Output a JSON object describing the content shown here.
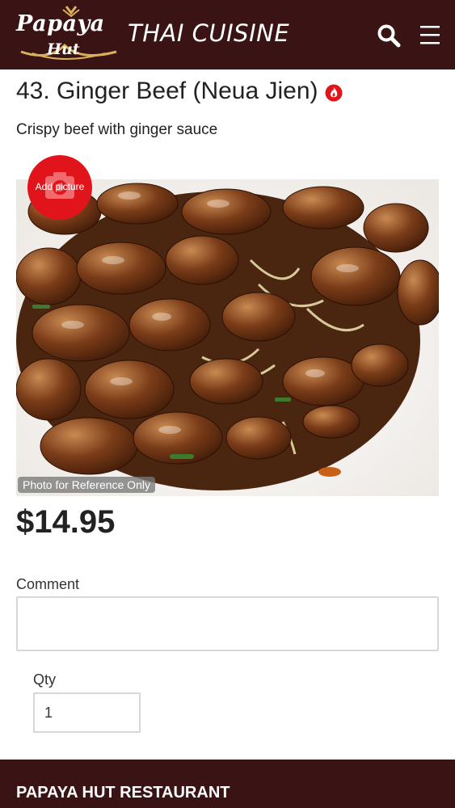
{
  "header": {
    "logo_title": "Papaya",
    "logo_sub": "Hut",
    "title": "THAI CUISINE",
    "search_icon": "search-icon",
    "menu_icon": "hamburger-menu-icon"
  },
  "dish": {
    "title": "43. Ginger Beef (Neua Jien)",
    "spicy_icon": "flame-icon",
    "description": "Crispy beef with ginger sauce",
    "add_picture_label": "Add picture",
    "photo_note": "Photo for Reference Only",
    "price": "$14.95"
  },
  "form": {
    "comment_label": "Comment",
    "comment_value": "",
    "qty_label": "Qty",
    "qty_value": "1"
  },
  "footer": {
    "title": "PAPAYA HUT RESTAURANT"
  },
  "colors": {
    "brand_dark": "#3a1414",
    "accent_red": "#e2141b"
  }
}
